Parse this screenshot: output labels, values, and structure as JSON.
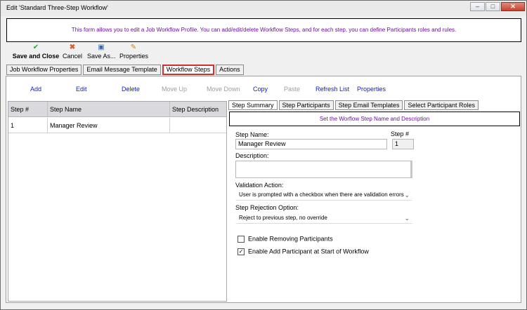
{
  "window": {
    "title": "Edit 'Standard Three-Step Workflow'",
    "minimize_glyph": "–",
    "maximize_glyph": "□",
    "close_glyph": "✕"
  },
  "info_text": "This form allows you to edit a Job Workflow Profile. You can add/edit/delete Workflow Steps, and for each step, you can define Participants roles and rules.",
  "toolbar": {
    "save_close": "Save and Close",
    "cancel": "Cancel",
    "save_as": "Save As...",
    "properties": "Properties",
    "icons": {
      "save_close": "checkmark-circle-icon",
      "cancel": "x-icon",
      "save_as": "floppy-disk-icon",
      "properties": "properties-icon"
    }
  },
  "main_tabs": [
    {
      "label": "Job Workflow Properties"
    },
    {
      "label": "Email Message Template"
    },
    {
      "label": "Workflow Steps",
      "active": true
    },
    {
      "label": "Actions"
    }
  ],
  "actions": [
    {
      "label": "Add",
      "enabled": true
    },
    {
      "label": "Edit",
      "enabled": true
    },
    {
      "label": "Delete",
      "enabled": true
    },
    {
      "label": "Move Up",
      "enabled": false
    },
    {
      "label": "Move Down",
      "enabled": false
    },
    {
      "label": "Copy",
      "enabled": true
    },
    {
      "label": "Paste",
      "enabled": false
    },
    {
      "label": "Refresh List",
      "enabled": true
    },
    {
      "label": "Properties",
      "enabled": true
    }
  ],
  "grid": {
    "columns": [
      "Step #",
      "Step Name",
      "Step Description"
    ],
    "rows": [
      [
        "1",
        "Manager Review",
        ""
      ]
    ]
  },
  "sub_tabs": [
    {
      "label": "Step Summary",
      "active": true
    },
    {
      "label": "Step Participants"
    },
    {
      "label": "Step Email Templates"
    },
    {
      "label": "Select Participant Roles"
    }
  ],
  "sub_info": "Set the Worflow Step Name and Description",
  "form": {
    "step_name_label": "Step Name:",
    "step_name_value": "Manager Review",
    "step_num_label": "Step #",
    "step_num_value": "1",
    "description_label": "Description:",
    "description_value": "",
    "validation_label": "Validation Action:",
    "validation_value": "User is prompted with a checkbox when there are validation errors",
    "rejection_label": "Step Rejection Option:",
    "rejection_value": "Reject to previous step, no override",
    "enable_removing_label": "Enable Removing Participants",
    "enable_removing_checked": false,
    "enable_add_label": "Enable Add Participant at Start of Workflow",
    "enable_add_checked": true,
    "dropdown_glyph": "⌄",
    "check_glyph": "✓"
  },
  "colors": {
    "info_text": "#6a0fa0",
    "link": "#1020c8",
    "disabled": "#9d9d9d",
    "active_tab_border": "#d42f2f"
  }
}
